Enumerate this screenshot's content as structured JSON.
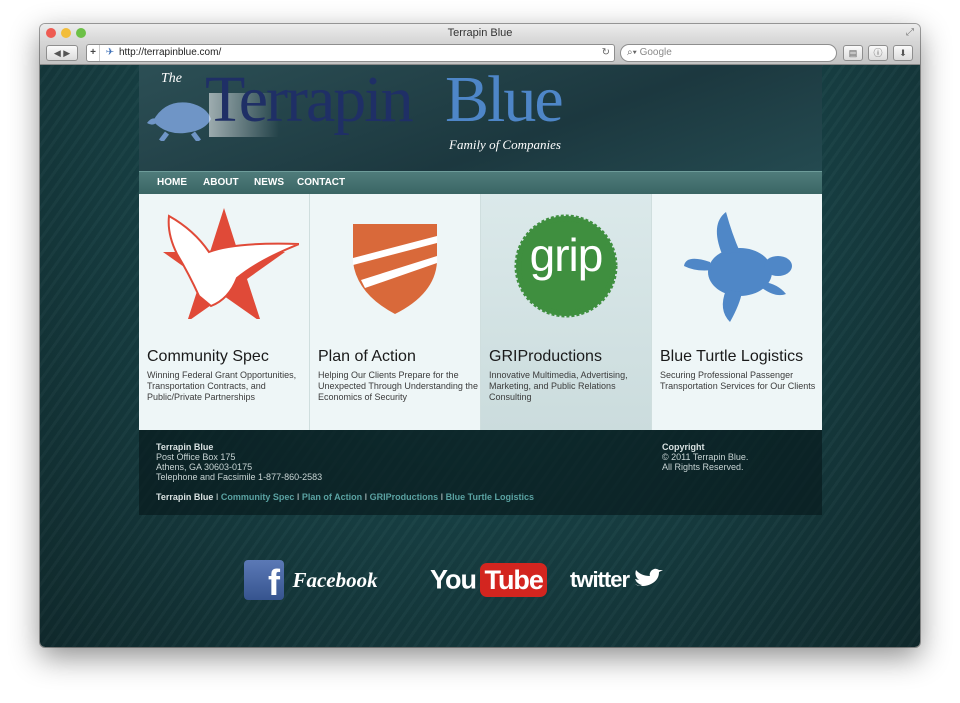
{
  "window": {
    "title": "Terrapin Blue"
  },
  "toolbar": {
    "url": "http://terrapinblue.com/",
    "search_placeholder": "Google",
    "add_label": "+"
  },
  "header": {
    "the": "The",
    "brand_terrapin": "Terrapin",
    "brand_blue": "Blue",
    "tagline": "Family of Companies"
  },
  "nav": {
    "home": "HOME",
    "about": "ABOUT",
    "news": "NEWS",
    "contact": "CONTACT"
  },
  "panels": [
    {
      "title": "Community Spec",
      "desc": "Winning Federal Grant Opportunities, Transportation Contracts, and Public/Private Partnerships"
    },
    {
      "title": "Plan of Action",
      "desc": "Helping Our Clients Prepare for the Unexpected Through Understanding the Economics of Security"
    },
    {
      "title": "GRIProductions",
      "desc": "Innovative Multimedia, Advertising, Marketing, and Public Relations Consulting",
      "logo_text": "grip"
    },
    {
      "title": "Blue Turtle Logistics",
      "desc": "Securing Professional Passenger Transportation Services for Our Clients"
    }
  ],
  "footer": {
    "company": "Terrapin Blue",
    "address1": "Post Office Box 175",
    "address2": "Athens, GA 30603-0175",
    "phone": "Telephone and Facsimile 1-877-860-2583",
    "copyright_title": "Copyright",
    "copyright_line1": "© 2011 Terrapin Blue.",
    "copyright_line2": "All Rights Reserved.",
    "links": [
      "Terrapin Blue",
      "Community Spec",
      "Plan of Action",
      "GRIProductions",
      "Blue Turtle Logistics"
    ],
    "separator": " I "
  },
  "social": {
    "facebook": "Facebook",
    "facebook_icon": "f",
    "youtube_you": "You",
    "youtube_tube": "Tube",
    "twitter": "twitter"
  },
  "colors": {
    "accent": "#4e86c8",
    "nav": "#3f6b6a",
    "footer_link": "#5aa2a2"
  }
}
